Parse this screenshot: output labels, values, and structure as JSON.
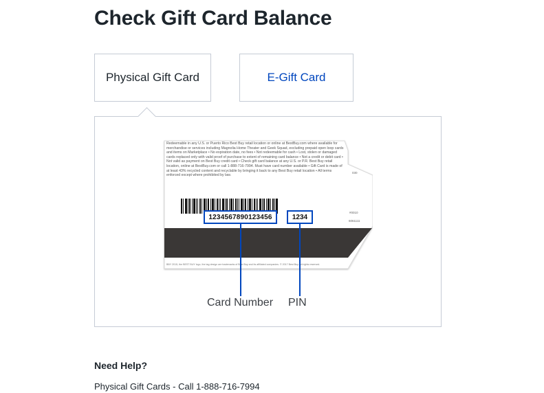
{
  "page": {
    "title": "Check Gift Card Balance"
  },
  "tabs": [
    {
      "label": "Physical Gift Card",
      "selected": true
    },
    {
      "label": "E-Gift Card",
      "selected": false
    }
  ],
  "card": {
    "fine_print": "Redeemable in any U.S. or Puerto Rico Best Buy retail location or online at BestBuy.com where available for merchandise or services including Magnolia Home Theater and Geek Squad, excluding prepaid open loop cards and items on Marketplace • No expiration date, no fees • Not redeemable for cash • Lost, stolen or damaged cards replaced only with valid proof of purchase to extent of remaining card balance • Not a credit or debit card • Not valid as payment on Best Buy credit card • Check gift card balance at any U.S. or P.R. Best Buy retail location, online at BestBuy.com or call 1-888-716-7994. Must have card number available • Gift Card is made of at least 43% recycled content and recyclable by bringing it back to any Best Buy retail location • All terms enforced except where prohibited by law.",
    "code_top": "030",
    "code_mid": "#0010",
    "code_low": "6061111",
    "footer_text": "BBY 2015, the BEST BUY logo, the tag design are trademarks of Best Buy and its affiliated companies. © 2017 Best Buy. All rights reserved.",
    "card_number": "1234567890123456",
    "pin": "1234",
    "label_card_number": "Card Number",
    "label_pin": "PIN",
    "accent_color": "#0046be"
  },
  "help": {
    "heading": "Need Help?",
    "physical_line": "Physical Gift Cards - Call 1-888-716-7994"
  }
}
